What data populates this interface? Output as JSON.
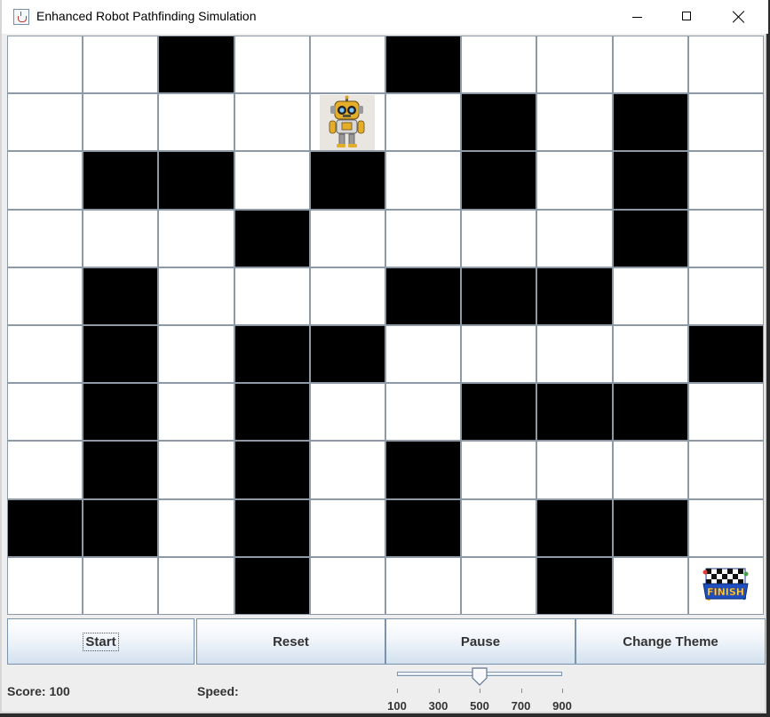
{
  "window": {
    "title": "Enhanced Robot Pathfinding Simulation"
  },
  "grid": {
    "rows": 10,
    "cols": 10,
    "walls": [
      [
        0,
        2
      ],
      [
        0,
        5
      ],
      [
        1,
        6
      ],
      [
        1,
        8
      ],
      [
        2,
        1
      ],
      [
        2,
        2
      ],
      [
        2,
        4
      ],
      [
        2,
        6
      ],
      [
        2,
        8
      ],
      [
        3,
        3
      ],
      [
        3,
        8
      ],
      [
        4,
        1
      ],
      [
        4,
        5
      ],
      [
        4,
        6
      ],
      [
        4,
        7
      ],
      [
        5,
        1
      ],
      [
        5,
        3
      ],
      [
        5,
        4
      ],
      [
        5,
        9
      ],
      [
        6,
        1
      ],
      [
        6,
        3
      ],
      [
        6,
        6
      ],
      [
        6,
        7
      ],
      [
        6,
        8
      ],
      [
        7,
        1
      ],
      [
        7,
        3
      ],
      [
        7,
        5
      ],
      [
        8,
        0
      ],
      [
        8,
        1
      ],
      [
        8,
        3
      ],
      [
        8,
        5
      ],
      [
        8,
        7
      ],
      [
        8,
        8
      ],
      [
        9,
        3
      ],
      [
        9,
        7
      ]
    ],
    "robot": [
      1,
      4
    ],
    "goal": [
      9,
      9
    ],
    "goal_text": "FINISH"
  },
  "buttons": {
    "start": "Start",
    "reset": "Reset",
    "pause": "Pause",
    "change_theme": "Change Theme"
  },
  "status": {
    "score_label": "Score: 100"
  },
  "speed": {
    "label": "Speed:",
    "min": 100,
    "max": 900,
    "value": 500,
    "ticks": [
      "100",
      "300",
      "500",
      "700",
      "900"
    ]
  }
}
